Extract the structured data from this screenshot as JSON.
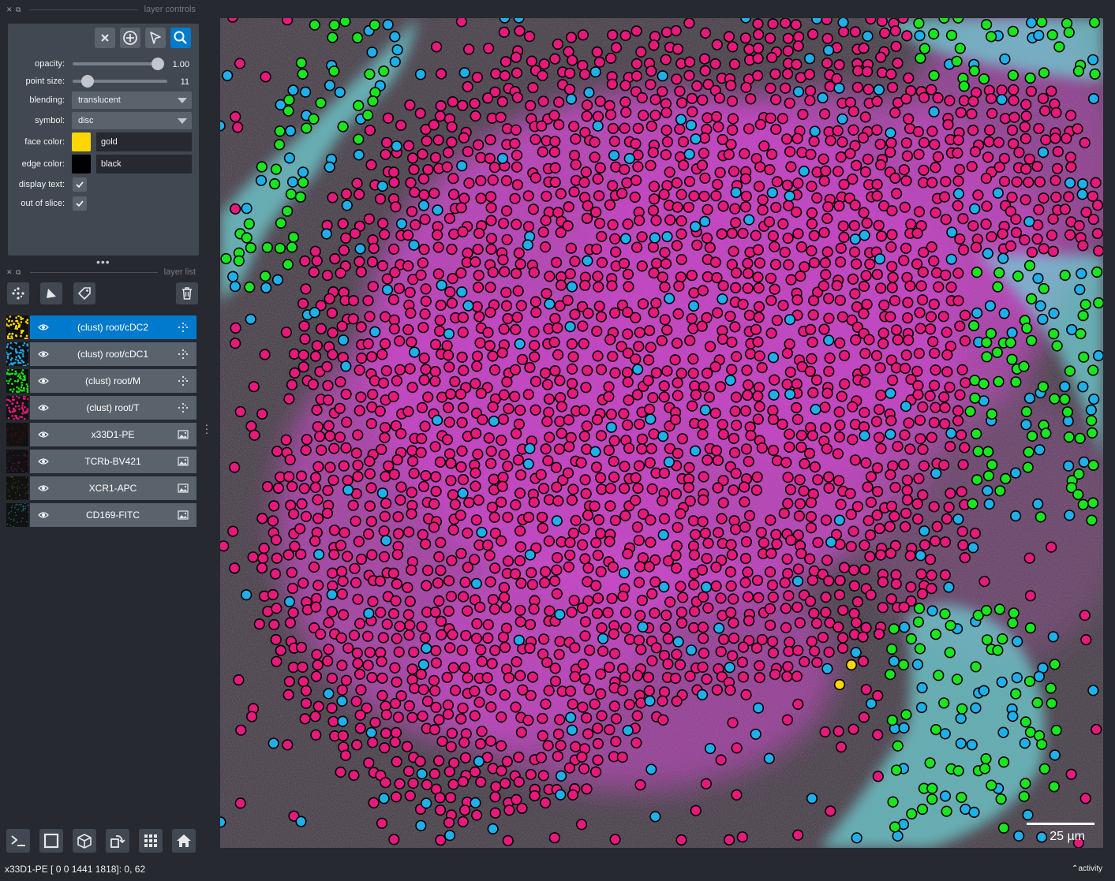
{
  "panels": {
    "layer_controls_title": "layer controls",
    "layer_list_title": "layer list"
  },
  "controls": {
    "opacity_label": "opacity:",
    "opacity_value": "1.00",
    "opacity_level": 1.0,
    "point_size_label": "point size:",
    "point_size_value": "11",
    "blending_label": "blending:",
    "blending_value": "translucent",
    "symbol_label": "symbol:",
    "symbol_value": "disc",
    "face_color_label": "face color:",
    "face_color_value": "gold",
    "face_color_hex": "#ffd700",
    "edge_color_label": "edge color:",
    "edge_color_value": "black",
    "edge_color_hex": "#000000",
    "display_text_label": "display text:",
    "display_text_checked": true,
    "out_of_slice_label": "out of slice:",
    "out_of_slice_checked": true
  },
  "layers": [
    {
      "name": "(clust) root/cDC2",
      "type": "points",
      "selected": true,
      "thumb_color": "#ffd700"
    },
    {
      "name": "(clust) root/cDC1",
      "type": "points",
      "selected": false,
      "thumb_color": "#1ea7e8"
    },
    {
      "name": "(clust) root/M",
      "type": "points",
      "selected": false,
      "thumb_color": "#19e619"
    },
    {
      "name": "(clust) root/T",
      "type": "points",
      "selected": false,
      "thumb_color": "#e6197a"
    },
    {
      "name": "x33D1-PE",
      "type": "image",
      "selected": false,
      "thumb_color": "#5a0a14"
    },
    {
      "name": "TCRb-BV421",
      "type": "image",
      "selected": false,
      "thumb_color": "#6a1070"
    },
    {
      "name": "XCR1-APC",
      "type": "image",
      "selected": false,
      "thumb_color": "#4a4a10"
    },
    {
      "name": "CD169-FITC",
      "type": "image",
      "selected": false,
      "thumb_color": "#1a7f8a"
    }
  ],
  "canvas": {
    "scale_label": "25 µm",
    "colors": {
      "tcell_fill": "#e8197c",
      "cdc1_fill": "#1eb0ea",
      "macrophage_fill": "#19e61e",
      "cdc2_fill": "#ffd700",
      "edge": "#000000",
      "magenta_signal": "#d92ed9",
      "cyan_signal": "#5fe3e8"
    }
  },
  "status": {
    "text": "x33D1-PE [   0     0 1441 1818]: 0, 62",
    "activity": "activity"
  }
}
